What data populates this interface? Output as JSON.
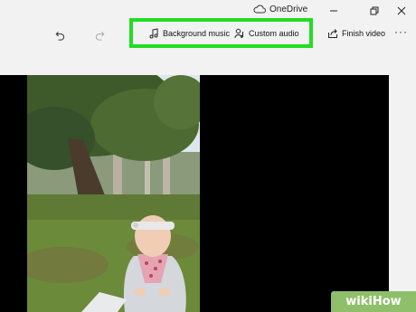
{
  "window": {
    "title": "OneDrive",
    "cloud_icon": "cloud-icon",
    "controls": [
      "minimize-icon",
      "restore-icon",
      "close-icon"
    ]
  },
  "toolbar": {
    "undo_icon": "undo-icon",
    "redo_icon": "redo-icon",
    "background_music_label": "Background music",
    "background_music_icon": "music-note-icon",
    "custom_audio_label": "Custom audio",
    "custom_audio_icon": "custom-audio-icon",
    "finish_video_label": "Finish video",
    "finish_video_icon": "share-icon",
    "more_label": "···",
    "highlight_color": "#22dd22"
  },
  "preview": {
    "background": "#000000",
    "content": "photo-preview"
  },
  "watermark": {
    "text": "wikiHow",
    "color": "#8fbf6b"
  }
}
